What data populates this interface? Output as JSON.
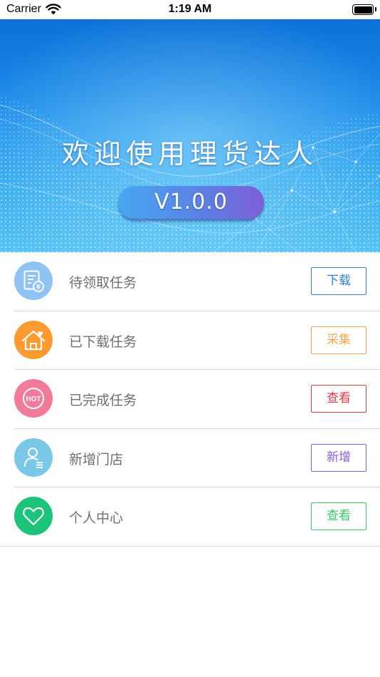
{
  "status_bar": {
    "carrier": "Carrier",
    "time": "1:19 AM"
  },
  "banner": {
    "title": "欢迎使用理货达人",
    "version": "V1.0.0"
  },
  "menu": [
    {
      "label": "待领取任务",
      "button": "下载",
      "icon": "receipt-yen-icon",
      "icon_color": "#8fc3f4",
      "button_color": "#2f7fd0"
    },
    {
      "label": "已下载任务",
      "button": "采集",
      "icon": "house-icon",
      "icon_color": "#ff9a2e",
      "button_color": "#f5a64a"
    },
    {
      "label": "已完成任务",
      "button": "查看",
      "icon": "hot-badge-icon",
      "icon_color": "#f27a9a",
      "button_color": "#e2394a"
    },
    {
      "label": "新增门店",
      "button": "新增",
      "icon": "user-list-icon",
      "icon_color": "#7ac8e8",
      "button_color": "#8a5ee0"
    },
    {
      "label": "个人中心",
      "button": "查看",
      "icon": "heart-icon",
      "icon_color": "#1cc37a",
      "button_color": "#37c96a"
    }
  ]
}
